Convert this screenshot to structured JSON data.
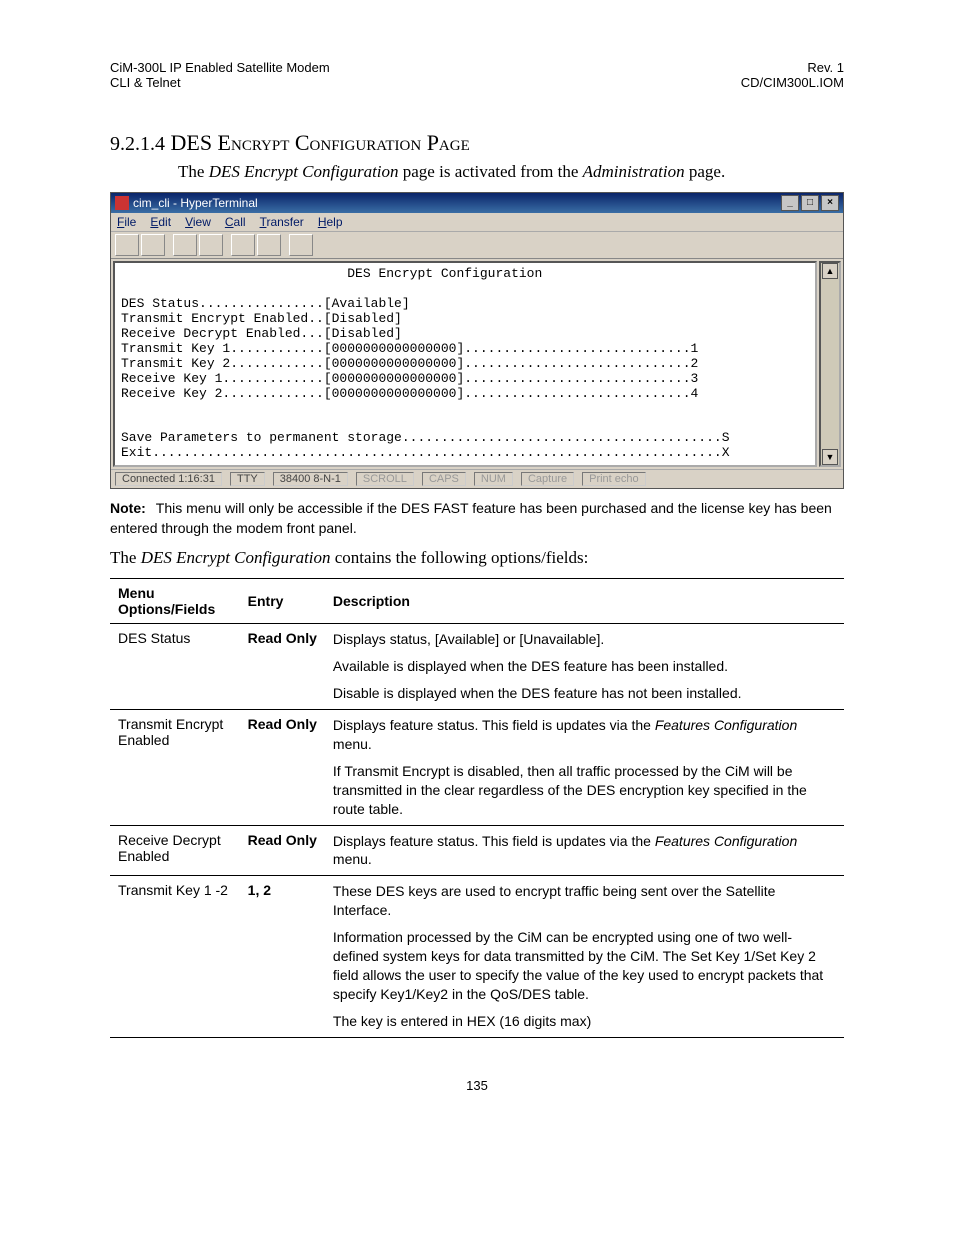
{
  "header": {
    "left1": "CiM-300L IP Enabled Satellite Modem",
    "left2": "CLI & Telnet",
    "right1": "Rev. 1",
    "right2": "CD/CIM300L.IOM"
  },
  "section": {
    "number": "9.2.1.4",
    "title": "DES Encrypt Configuration Page"
  },
  "intro": {
    "pre": "The ",
    "em1": "DES Encrypt Configuration",
    "mid": " page is activated from the ",
    "em2": "Administration",
    "post": " page."
  },
  "ht": {
    "title": "cim_cli - HyperTerminal",
    "menu": [
      "File",
      "Edit",
      "View",
      "Call",
      "Transfer",
      "Help"
    ],
    "terminal": "                             DES Encrypt Configuration\n\nDES Status................[Available]\nTransmit Encrypt Enabled..[Disabled]\nReceive Decrypt Enabled...[Disabled]\nTransmit Key 1............[0000000000000000].............................1\nTransmit Key 2............[0000000000000000].............................2\nReceive Key 1.............[0000000000000000].............................3\nReceive Key 2.............[0000000000000000].............................4\n\n\nSave Parameters to permanent storage.........................................S\nExit.........................................................................X\n",
    "status": {
      "connected": "Connected 1:16:31",
      "tty": "TTY",
      "baud": "38400 8-N-1",
      "items": [
        "SCROLL",
        "CAPS",
        "NUM",
        "Capture",
        "Print echo"
      ]
    }
  },
  "note": {
    "label": "Note:",
    "text": "This menu will only be accessible if the DES FAST feature has been purchased and the license key has been entered through the modem front panel."
  },
  "lead2": {
    "pre": "The ",
    "em": "DES Encrypt Configuration",
    "post": " contains the following options/fields:"
  },
  "table": {
    "headers": [
      "Menu Options/Fields",
      "Entry",
      "Description"
    ],
    "rows": [
      {
        "field": "DES Status",
        "entry": "Read Only",
        "desc": [
          "Displays status, [Available] or [Unavailable].",
          "Available is displayed when the DES feature has been installed.",
          "Disable is displayed when the DES feature has not been installed."
        ]
      },
      {
        "field": "Transmit Encrypt Enabled",
        "entry": "Read Only",
        "desc_mixed": [
          {
            "plain_pre": "Displays feature status. This field is updates via the ",
            "em": "Features Configuration",
            "plain_post": " menu."
          },
          {
            "plain_pre": "If Transmit Encrypt is disabled, then all traffic processed by the CiM will be transmitted in the clear regardless of the DES encryption key specified in the route table.",
            "em": "",
            "plain_post": ""
          }
        ]
      },
      {
        "field": "Receive Decrypt Enabled",
        "entry": "Read Only",
        "desc_mixed": [
          {
            "plain_pre": "Displays feature status. This field is updates via the ",
            "em": "Features Configuration",
            "plain_post": " menu."
          }
        ]
      },
      {
        "field": "Transmit Key 1 -2",
        "entry": "1, 2",
        "desc": [
          "These DES keys are used to encrypt traffic being sent over the Satellite Interface.",
          "Information processed by the CiM can be encrypted using one of two well-defined system keys for data transmitted by the CiM. The Set Key 1/Set Key 2 field allows the user to specify the value of the key used to encrypt packets that specify Key1/Key2 in the QoS/DES table.",
          "The key is entered in HEX (16 digits max)"
        ]
      }
    ]
  },
  "page_number": "135"
}
